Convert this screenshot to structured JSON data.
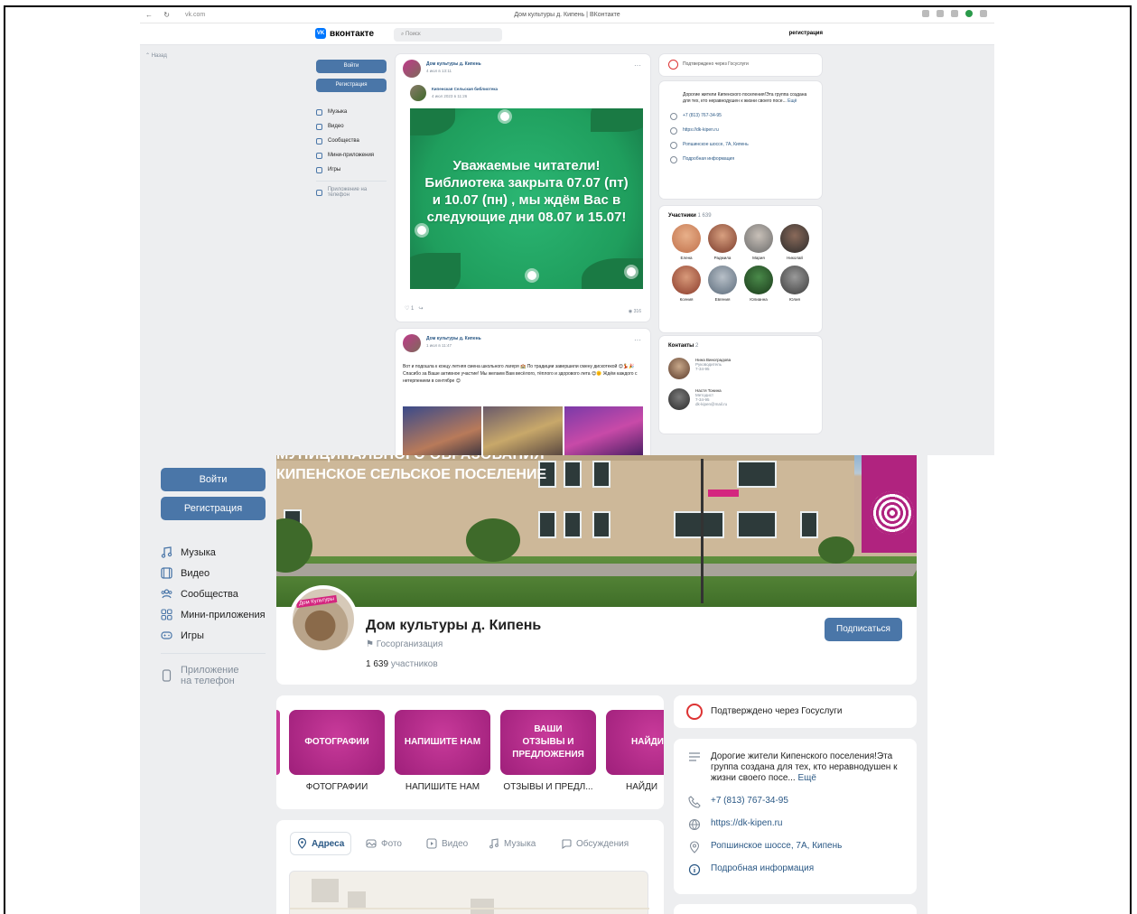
{
  "browser": {
    "url": "vk.com",
    "title": "Дом культуры д. Кипень | ВКонтакте"
  },
  "top": {
    "logo": "вконтакте",
    "search_placeholder": "Поиск",
    "register_link": "регистрация",
    "back": "Назад",
    "login": "Войти",
    "register": "Регистрация",
    "menu": [
      "Музыка",
      "Видео",
      "Сообщества",
      "Мини-приложения",
      "Игры"
    ],
    "app_link": "Приложение на телефон",
    "post1": {
      "author": "Дом культуры д. Кипень",
      "date": "4 июл в 13:11",
      "repost_author": "Кипенская Сельская библиотека",
      "repost_date": "4 июл 2023 в 11:26",
      "banner_text": "Уважаемые читатели! Библиотека закрыта 07.07 (пт) и 10.07 (пн) , мы ждём Вас в следующие дни 08.07 и 15.07!",
      "likes": "1",
      "views": "316"
    },
    "post2": {
      "author": "Дом культуры д. Кипень",
      "date": "1 июл в 11:47",
      "text": "Вот и подошла к концу летняя смена школьного лагеря 🏫 По традиции завершили смену дискотекой 😊💃🎉 Спасибо за Ваше активное участие! Мы желаем Вам весёлого, тёплого и здорового лета 😊🌞 Ждём каждого с нетерпением в сентябре 😊"
    },
    "gosuslugi": "Подтверждено через Госуслуги",
    "info": {
      "description": "Дорогие жители Кипенского поселения!Эта группа создана для тех, кто неравнодушен к жизни своего посе...",
      "more": "Ещё",
      "phone": "+7 (813) 767-34-95",
      "site": "https://dk-kipen.ru",
      "address": "Ропшинское шоссе, 7А, Кипень",
      "details": "Подробная информация"
    },
    "members": {
      "title": "Участники",
      "count": "1 639",
      "names": [
        "Елена",
        "Радмила",
        "Мария",
        "Николай",
        "Ксения",
        "Евгения",
        "Юлианна",
        "Юлия"
      ]
    },
    "contacts": {
      "title": "Контакты",
      "count": "2",
      "people": [
        {
          "name": "Нина Виноградова",
          "role": "Руководитель",
          "extra": "7-34-95"
        },
        {
          "name": "Настя Тонина",
          "role": "Методист",
          "extra": "7-34-95",
          "email": "dk-kipen@mail.ru"
        }
      ]
    }
  },
  "bottom": {
    "login": "Войти",
    "register": "Регистрация",
    "menu": [
      "Музыка",
      "Видео",
      "Сообщества",
      "Мини-приложения",
      "Игры"
    ],
    "app_link_1": "Приложение",
    "app_link_2": "на телефон",
    "cover_line1": "МУНИЦИПАЛЬНОГО ОБРАЗОВАНИЯ",
    "cover_line2": "КИПЕНСКОЕ СЕЛЬСКОЕ ПОСЕЛЕНИЕ",
    "avatar_tag": "Дом Культуры",
    "group_name": "Дом культуры д. Кипень",
    "group_type": "Госорганизация",
    "members_count": "1 639",
    "members_label": "участников",
    "subscribe": "Подписаться",
    "links": [
      {
        "tile": "ФОТОГРАФИИ",
        "caption": "ФОТОГРАФИИ"
      },
      {
        "tile": "НАПИШИТЕ НАМ",
        "caption": "НАПИШИТЕ НАМ"
      },
      {
        "tile": "ВАШИ ОТЗЫВЫ И ПРЕДЛОЖЕНИЯ",
        "caption": "ОТЗЫВЫ И ПРЕДЛ..."
      },
      {
        "tile": "НАЙДИ",
        "caption": "НАЙДИ"
      }
    ],
    "tabs": [
      "Адреса",
      "Фото",
      "Видео",
      "Музыка",
      "Обсуждения"
    ],
    "gosuslugi": "Подтверждено через Госуслуги",
    "info": {
      "description": "Дорогие жители Кипенского поселения!Эта группа создана для тех, кто неравнодушен к жизни своего посе...",
      "more": "Ещё",
      "phone": "+7 (813) 767-34-95",
      "site": "https://dk-kipen.ru",
      "address": "Ропшинское шоссе, 7А, Кипень",
      "details": "Подробная информация"
    }
  }
}
